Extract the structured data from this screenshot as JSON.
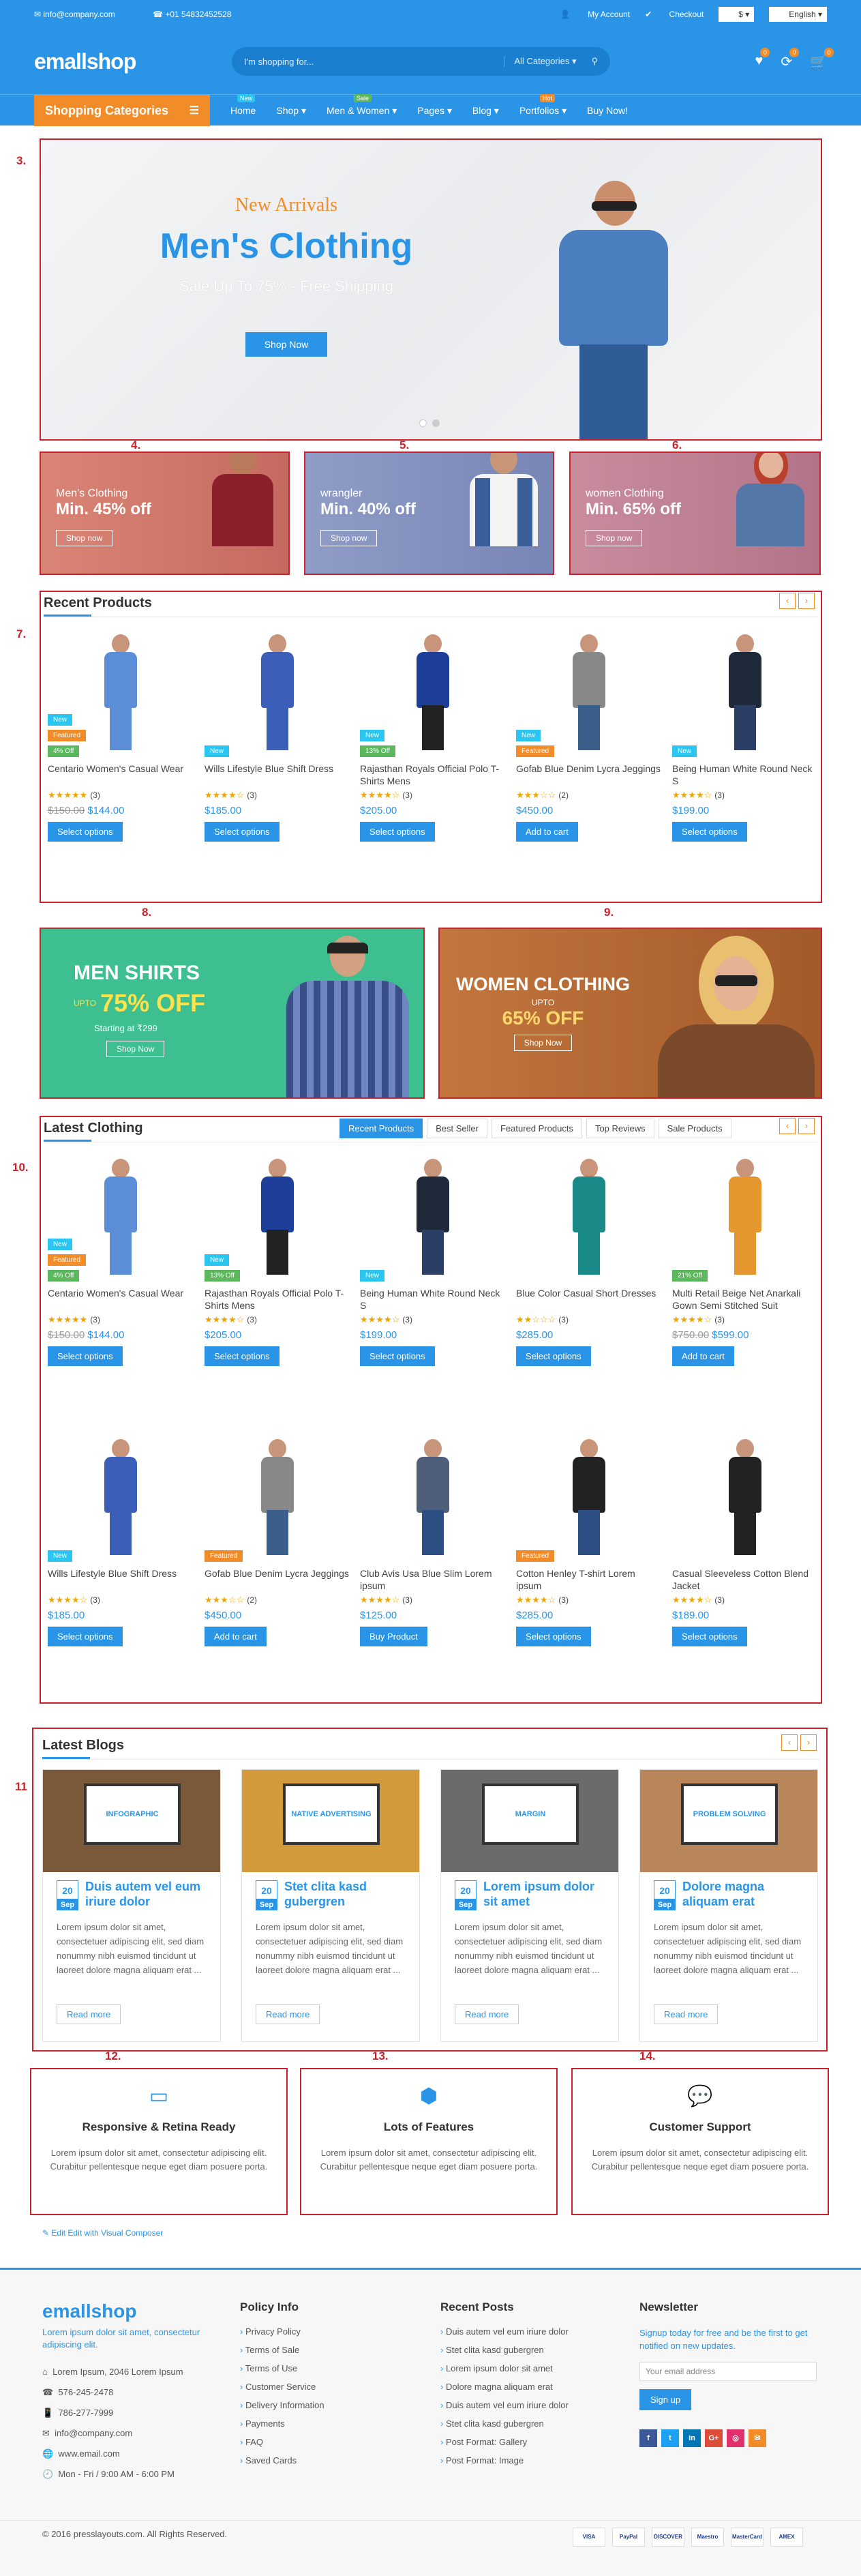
{
  "topbar": {
    "email": "info@company.com",
    "phone": "+01 54832452528",
    "my_account": "My Account",
    "checkout": "Checkout",
    "currency": "$",
    "language": "English"
  },
  "header": {
    "logo": "emallshop",
    "search_placeholder": "I'm shopping for...",
    "search_category": "All Categories",
    "wishlist_count": "0",
    "compare_count": "0",
    "cart_count": "0"
  },
  "nav": {
    "shop_categories": "Shopping Categories",
    "items": [
      "Home",
      "Shop",
      "Men & Women",
      "Pages",
      "Blog",
      "Portfolios",
      "Buy Now!"
    ],
    "badges": {
      "home": "New",
      "men_women": "Sale",
      "portfolios": "Hot"
    }
  },
  "labels": [
    "3.",
    "4.",
    "5.",
    "6.",
    "7.",
    "8.",
    "9.",
    "10.",
    "11",
    "12.",
    "13.",
    "14."
  ],
  "hero": {
    "kicker": "New Arrivals",
    "title": "Men's Clothing",
    "subtitle": "Sale Up To 75% - Free Shipping",
    "button": "Shop Now"
  },
  "banners": [
    {
      "small": "Men's Clothing",
      "big": "Min. 45% off",
      "button": "Shop now"
    },
    {
      "small": "wrangler",
      "big": "Min. 40% off",
      "button": "Shop now"
    },
    {
      "small": "women Clothing",
      "big": "Min. 65% off",
      "button": "Shop now"
    }
  ],
  "recent": {
    "title": "Recent Products",
    "products": [
      {
        "badges": [
          "New",
          "Featured",
          "4% Off"
        ],
        "name": "Centario Women's Casual Wear",
        "rating": "★★★★★",
        "count": "(3)",
        "old": "$150.00",
        "price": "$144.00",
        "button": "Select options"
      },
      {
        "badges": [
          "New"
        ],
        "name": "Wills Lifestyle Blue Shift Dress",
        "rating": "★★★★☆",
        "count": "(3)",
        "old": "",
        "price": "$185.00",
        "button": "Select options"
      },
      {
        "badges": [
          "New",
          "13% Off"
        ],
        "name": "Rajasthan Royals Official Polo T-Shirts Mens",
        "rating": "★★★★☆",
        "count": "(3)",
        "old": "",
        "price": "$205.00",
        "button": "Select options"
      },
      {
        "badges": [
          "New",
          "Featured"
        ],
        "name": "Gofab Blue Denim Lycra Jeggings",
        "rating": "★★★☆☆",
        "count": "(2)",
        "old": "",
        "price": "$450.00",
        "button": "Add to cart"
      },
      {
        "badges": [
          "New"
        ],
        "name": "Being Human White Round Neck S",
        "rating": "★★★★☆",
        "count": "(3)",
        "old": "",
        "price": "$199.00",
        "button": "Select options"
      }
    ]
  },
  "promo": [
    {
      "title": "MEN SHIRTS",
      "upto": "UPTO",
      "off": "75% OFF",
      "sub": "Starting at ₹299",
      "button": "Shop Now"
    },
    {
      "title": "WOMEN CLOTHING",
      "upto": "UPTO",
      "off": "65% OFF",
      "button": "Shop Now"
    }
  ],
  "latest": {
    "title": "Latest Clothing",
    "tabs": [
      "Recent Products",
      "Best Seller",
      "Featured Products",
      "Top Reviews",
      "Sale Products"
    ],
    "products": [
      {
        "badges": [
          "New",
          "Featured",
          "4% Off"
        ],
        "name": "Centario Women's Casual Wear",
        "rating": "★★★★★",
        "count": "(3)",
        "old": "$150.00",
        "price": "$144.00",
        "button": "Select options"
      },
      {
        "badges": [
          "New",
          "13% Off"
        ],
        "name": "Rajasthan Royals Official Polo T-Shirts Mens",
        "rating": "★★★★☆",
        "count": "(3)",
        "old": "",
        "price": "$205.00",
        "button": "Select options"
      },
      {
        "badges": [
          "New"
        ],
        "name": "Being Human White Round Neck S",
        "rating": "★★★★☆",
        "count": "(3)",
        "old": "",
        "price": "$199.00",
        "button": "Select options"
      },
      {
        "badges": [],
        "name": "Blue Color Casual Short Dresses",
        "rating": "★★☆☆☆",
        "count": "(3)",
        "old": "",
        "price": "$285.00",
        "button": "Select options"
      },
      {
        "badges": [
          "21% Off"
        ],
        "name": "Multi Retail Beige Net Anarkali Gown Semi Stitched Suit",
        "rating": "★★★★☆",
        "count": "(3)",
        "old": "$750.00",
        "price": "$599.00",
        "button": "Add to cart"
      },
      {
        "badges": [
          "New"
        ],
        "name": "Wills Lifestyle Blue Shift Dress",
        "rating": "★★★★☆",
        "count": "(3)",
        "old": "",
        "price": "$185.00",
        "button": "Select options"
      },
      {
        "badges": [
          "Featured"
        ],
        "name": "Gofab Blue Denim Lycra Jeggings",
        "rating": "★★★☆☆",
        "count": "(2)",
        "old": "",
        "price": "$450.00",
        "button": "Add to cart"
      },
      {
        "badges": [],
        "name": "Club Avis Usa Blue Slim Lorem ipsum",
        "rating": "★★★★☆",
        "count": "(3)",
        "old": "",
        "price": "$125.00",
        "button": "Buy Product"
      },
      {
        "badges": [
          "Featured"
        ],
        "name": "Cotton Henley T-shirt Lorem ipsum",
        "rating": "★★★★☆",
        "count": "(3)",
        "old": "",
        "price": "$285.00",
        "button": "Select options"
      },
      {
        "badges": [],
        "name": "Casual Sleeveless Cotton Blend Jacket",
        "rating": "★★★★☆",
        "count": "(3)",
        "old": "",
        "price": "$189.00",
        "button": "Select options"
      }
    ]
  },
  "blogs": {
    "title": "Latest Blogs",
    "posts": [
      {
        "day": "20",
        "month": "Sep",
        "title": "Duis autem vel eum iriure dolor",
        "excerpt": "Lorem ipsum dolor sit amet, consectetuer adipiscing elit, sed diam nonummy nibh euismod tincidunt ut laoreet dolore magna aliquam erat ...",
        "more": "Read more",
        "img": "INFOGRAPHIC"
      },
      {
        "day": "20",
        "month": "Sep",
        "title": "Stet clita kasd gubergren",
        "excerpt": "Lorem ipsum dolor sit amet, consectetuer adipiscing elit, sed diam nonummy nibh euismod tincidunt ut laoreet dolore magna aliquam erat ...",
        "more": "Read more",
        "img": "NATIVE ADVERTISING"
      },
      {
        "day": "20",
        "month": "Sep",
        "title": "Lorem ipsum dolor sit amet",
        "excerpt": "Lorem ipsum dolor sit amet, consectetuer adipiscing elit, sed diam nonummy nibh euismod tincidunt ut laoreet dolore magna aliquam erat ...",
        "more": "Read more",
        "img": "MARGIN"
      },
      {
        "day": "20",
        "month": "Sep",
        "title": "Dolore magna aliquam erat",
        "excerpt": "Lorem ipsum dolor sit amet, consectetuer adipiscing elit, sed diam nonummy nibh euismod tincidunt ut laoreet dolore magna aliquam erat ...",
        "more": "Read more",
        "img": "PROBLEM SOLVING"
      }
    ]
  },
  "features": [
    {
      "title": "Responsive & Retina Ready",
      "desc": "Lorem ipsum dolor sit amet, consectetur adipiscing elit. Curabitur pellentesque neque eget diam posuere porta."
    },
    {
      "title": "Lots of Features",
      "desc": "Lorem ipsum dolor sit amet, consectetur adipiscing elit. Curabitur pellentesque neque eget diam posuere porta."
    },
    {
      "title": "Customer Support",
      "desc": "Lorem ipsum dolor sit amet, consectetur adipiscing elit. Curabitur pellentesque neque eget diam posuere porta."
    }
  ],
  "edit_link": "Edit Edit with Visual Composer",
  "footer": {
    "about": "Lorem ipsum dolor sit amet, consectetur adipiscing elit.",
    "contacts": [
      "Lorem Ipsum, 2046 Lorem Ipsum",
      "576-245-2478",
      "786-277-7999",
      "info@company.com",
      "www.email.com",
      "Mon - Fri / 9:00 AM - 6:00 PM"
    ],
    "policy_title": "Policy Info",
    "policy": [
      "Privacy Policy",
      "Terms of Sale",
      "Terms of Use",
      "Customer Service",
      "Delivery Information",
      "Payments",
      "FAQ",
      "Saved Cards"
    ],
    "posts_title": "Recent Posts",
    "posts": [
      "Duis autem vel eum iriure dolor",
      "Stet clita kasd gubergren",
      "Lorem ipsum dolor sit amet",
      "Dolore magna aliquam erat",
      "Duis autem vel eum iriure dolor",
      "Stet clita kasd gubergren",
      "Post Format: Gallery",
      "Post Format: Image"
    ],
    "news_title": "Newsletter",
    "news_text": "Signup today for free and be the first to get notified on new updates.",
    "news_placeholder": "Your email address",
    "news_button": "Sign up",
    "social": [
      "f",
      "t",
      "in",
      "G+",
      "◎",
      "✉"
    ],
    "copyright": "© 2016 presslayouts.com. All Rights Reserved.",
    "payments": [
      "VISA",
      "PayPal",
      "DISCOVER",
      "Maestro",
      "MasterCard",
      "AMEX"
    ]
  },
  "colors": {
    "primary": "#2a95e6",
    "accent": "#f28c28",
    "annotation": "#c8232c"
  }
}
